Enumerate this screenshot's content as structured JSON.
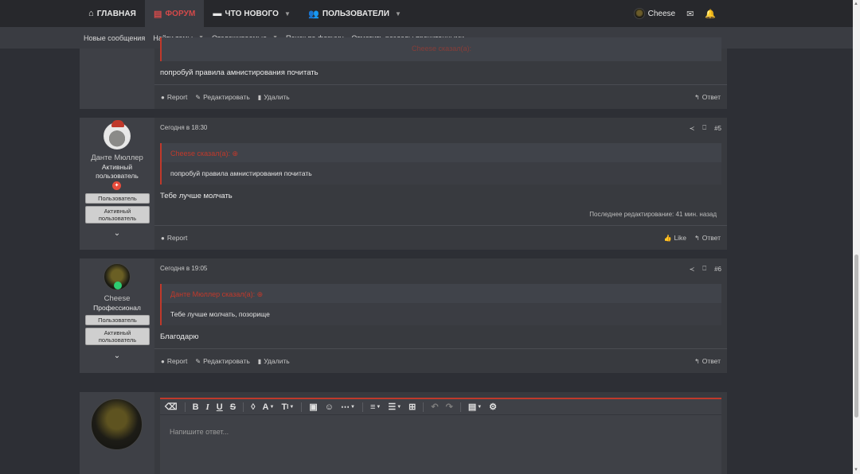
{
  "nav": {
    "tabs": [
      {
        "label": "ГЛАВНАЯ",
        "icon": "home-icon"
      },
      {
        "label": "ФОРУМ",
        "icon": "forum-icon",
        "active": true
      },
      {
        "label": "ЧТО НОВОГО",
        "icon": "chat-icon"
      },
      {
        "label": "ПОЛЬЗОВАТЕЛИ",
        "icon": "users-icon"
      }
    ],
    "username": "Cheese",
    "accent": "#d44a4a"
  },
  "subnav": [
    "Новые сообщения",
    "Найти темы",
    "Отслеживаемые",
    "Поиск по форуму",
    "Отметить разделы прочитанными"
  ],
  "post1": {
    "quote_head": "Cheese сказал(а):",
    "message": "попробуй правила амнистирования почитать",
    "actions": {
      "report": "Report",
      "edit": "Редактировать",
      "delete": "Удалить",
      "reply": "Ответ"
    }
  },
  "post2": {
    "username": "Данте Мюллер",
    "user_title": "Активный пользователь",
    "banners": [
      "Пользователь",
      "Активный пользователь"
    ],
    "time": "Сегодня в 18:30",
    "number": "#5",
    "quote_head": "Cheese сказал(а):",
    "quote_body": "попробуй правила амнистирования почитать",
    "message": "Тебе лучше молчать",
    "edited": "Последнее редактирование: 41 мин. назад",
    "actions": {
      "report": "Report",
      "like": "Like",
      "reply": "Ответ"
    }
  },
  "post3": {
    "username": "Cheese",
    "user_title": "Профессионал",
    "banners": [
      "Пользователь",
      "Активный пользователь"
    ],
    "time": "Сегодня в 19:05",
    "number": "#6",
    "quote_head": "Данте Мюллер сказал(а):",
    "quote_body": "Тебе лучше молчать, позорище",
    "message": "Благодарю",
    "actions": {
      "report": "Report",
      "edit": "Редактировать",
      "delete": "Удалить",
      "reply": "Ответ"
    }
  },
  "reply_box": {
    "placeholder": "Напишите ответ..."
  }
}
